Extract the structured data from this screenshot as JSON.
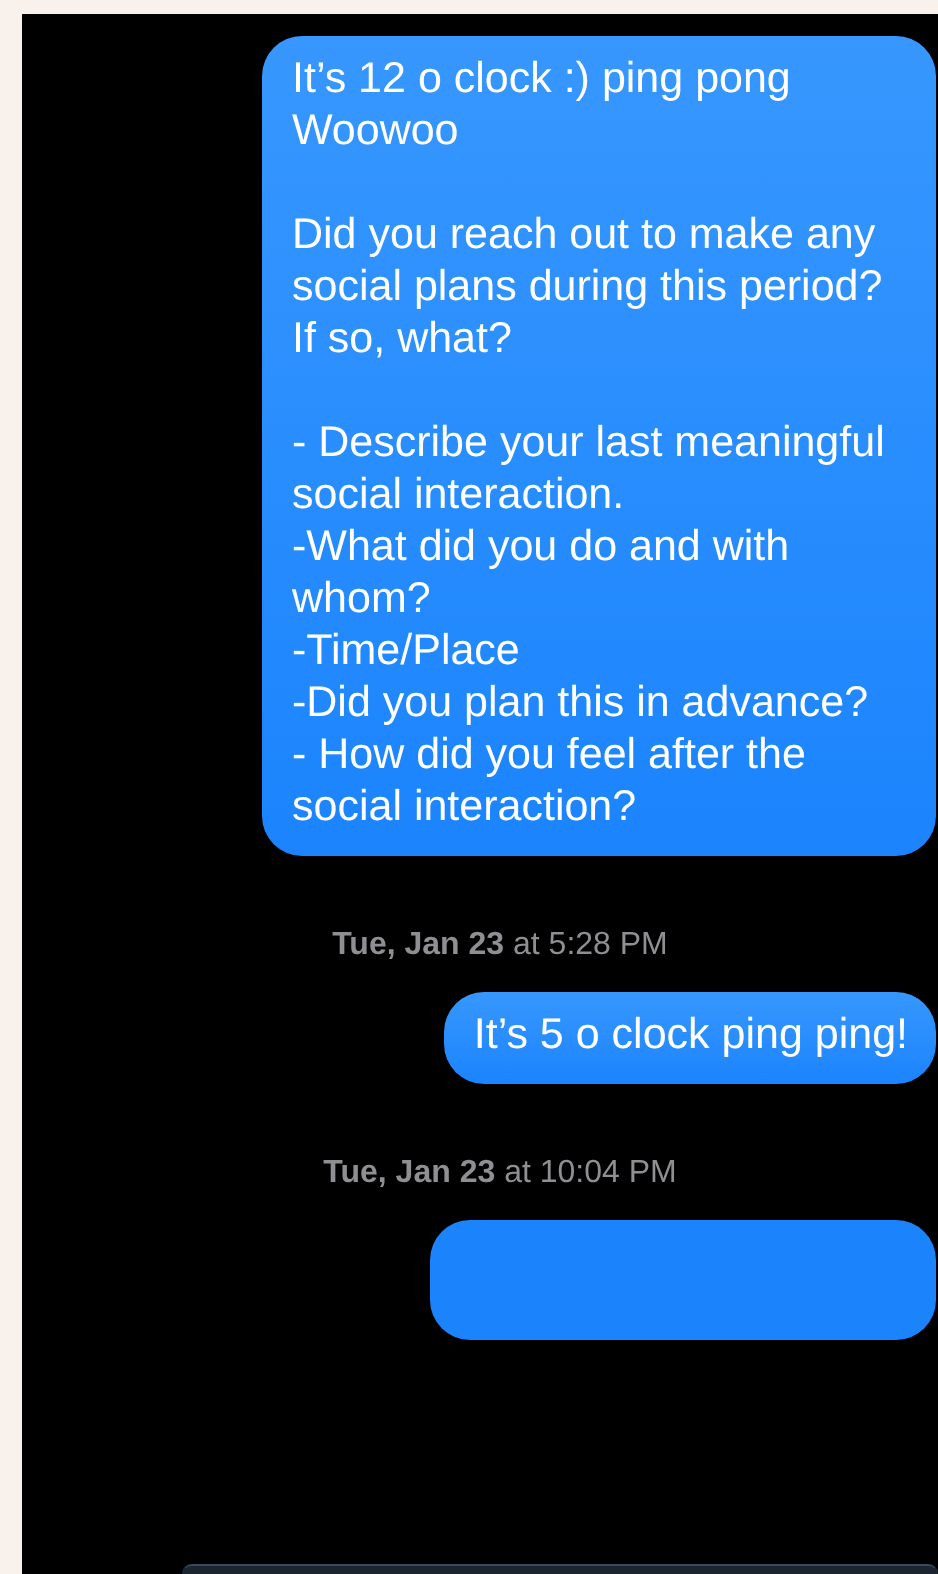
{
  "messages": [
    {
      "kind": "bubble",
      "text": "It’s 12 o clock :) ping pong\nWoowoo\n\nDid you reach out to make any social plans during this period? If so, what?\n\n- Describe your last meaningful social interaction.\n-What did you do and with whom?\n-Time/Place\n-Did you plan this in advance?\n- How did you feel after the social interaction?"
    },
    {
      "kind": "timestamp",
      "text": "**Tue, Jan 23** at 5:28 PM"
    },
    {
      "kind": "bubble",
      "text": "It’s 5 o clock ping ping!"
    },
    {
      "kind": "timestamp",
      "text": "**Tue, Jan 23** at 10:04 PM"
    },
    {
      "kind": "cut-bubble"
    }
  ]
}
